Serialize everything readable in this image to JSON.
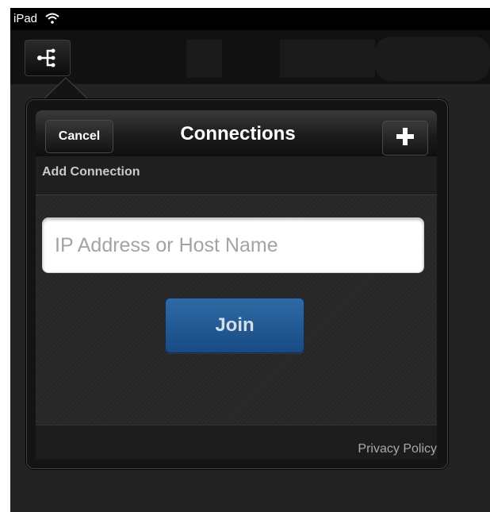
{
  "status_bar": {
    "carrier": "iPad",
    "wifi_icon": "wifi-icon"
  },
  "navbar": {
    "button_icon": "network-share-icon"
  },
  "popover": {
    "title": "Connections",
    "cancel_label": "Cancel",
    "add_icon": "plus-icon",
    "section_title": "Add Connection",
    "host_input": {
      "value": "",
      "placeholder": "IP Address or Host Name"
    },
    "join_label": "Join",
    "privacy_label": "Privacy Policy"
  },
  "colors": {
    "join_button": "#1f5a96",
    "background": "#232323"
  }
}
